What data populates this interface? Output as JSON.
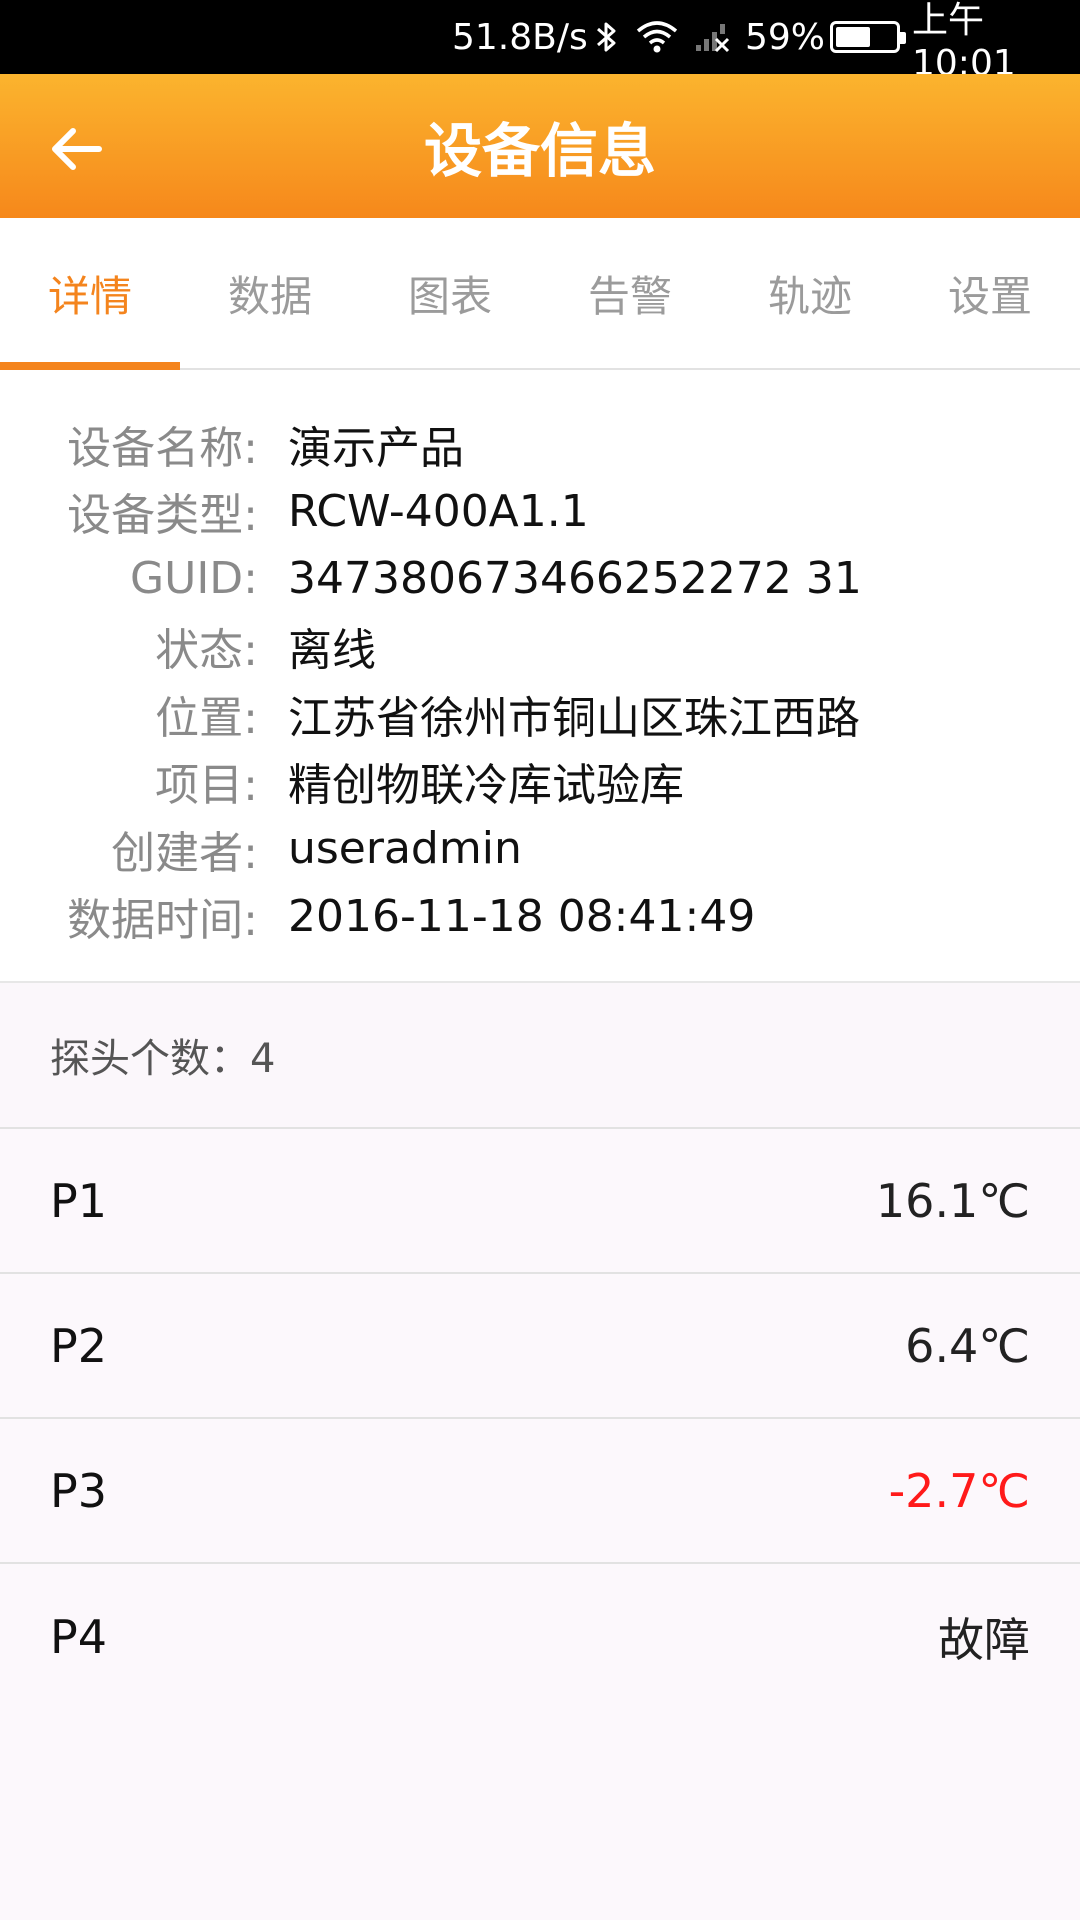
{
  "status_bar": {
    "net_speed": "51.8B/s",
    "battery_percent": "59%",
    "battery_level": 0.59,
    "time": "上午10:01",
    "icons": [
      "bluetooth-icon",
      "wifi-icon",
      "no-signal-icon",
      "battery-icon"
    ]
  },
  "app_bar": {
    "title": "设备信息",
    "back_icon": "arrow-left-icon",
    "background_color": "#f8941f"
  },
  "tabs": [
    {
      "label": "详情",
      "active": true
    },
    {
      "label": "数据",
      "active": false
    },
    {
      "label": "图表",
      "active": false
    },
    {
      "label": "告警",
      "active": false
    },
    {
      "label": "轨迹",
      "active": false
    },
    {
      "label": "设置",
      "active": false
    }
  ],
  "accent_color": "#f4841d",
  "details": [
    {
      "label": "设备名称:",
      "value": "演示产品"
    },
    {
      "label": "设备类型:",
      "value": "RCW-400A1.1"
    },
    {
      "label": "GUID:",
      "value": "347380673466252272 31"
    },
    {
      "label": "状态:",
      "value": "离线"
    },
    {
      "label": "位置:",
      "value": "江苏省徐州市铜山区珠江西路"
    },
    {
      "label": "项目:",
      "value": "精创物联冷库试验库"
    },
    {
      "label": "创建者:",
      "value": "useradmin"
    },
    {
      "label": "数据时间:",
      "value": "2016-11-18 08:41:49"
    }
  ],
  "probe_count_text": "探头个数：4",
  "probes": [
    {
      "name": "P1",
      "value": "16.1℃",
      "alert": false
    },
    {
      "name": "P2",
      "value": "6.4℃",
      "alert": false
    },
    {
      "name": "P3",
      "value": "-2.7℃",
      "alert": true
    },
    {
      "name": "P4",
      "value": "故障",
      "alert": false
    }
  ],
  "alert_color": "#ff1a1a"
}
